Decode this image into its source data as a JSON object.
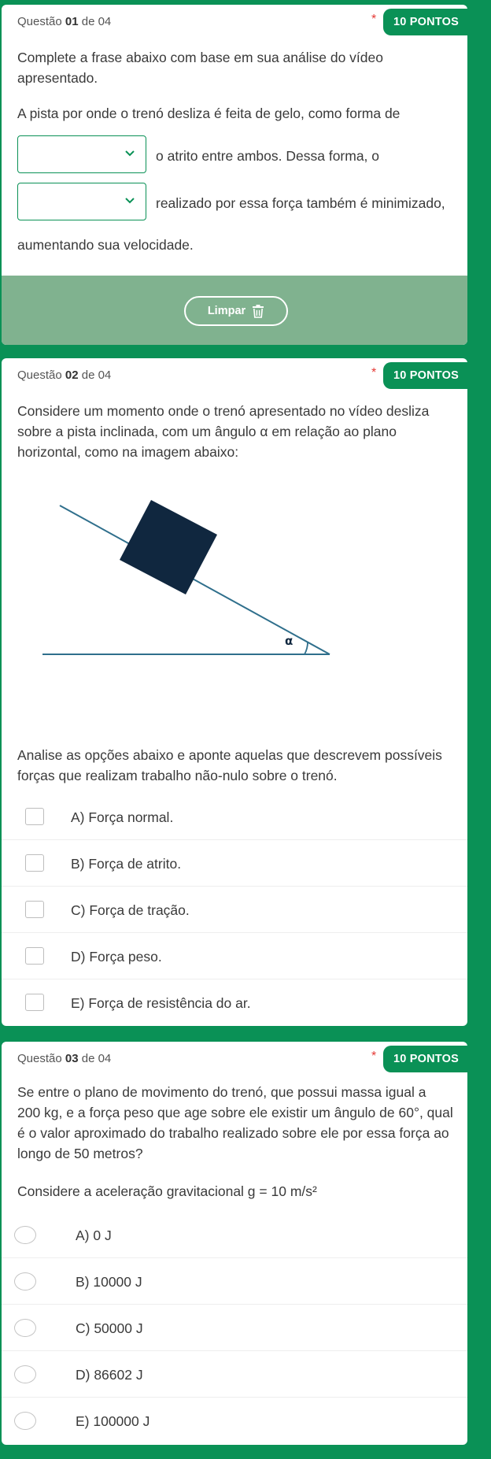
{
  "q1": {
    "label_prefix": "Questão ",
    "number": "01",
    "label_suffix": " de 04",
    "required_mark": "*",
    "points": "10 PONTOS",
    "prompt": "Complete a frase abaixo com base em sua análise do vídeo apresentado.",
    "sentence_start": "A pista por onde o trenó desliza é feita de gelo, como forma de",
    "after_select1": "o atrito entre ambos. Dessa forma, o",
    "after_select2": "realizado por essa força também é minimizado,",
    "sentence_end": "aumentando sua velocidade.",
    "select1_value": "",
    "select2_value": "",
    "clear_label": "Limpar"
  },
  "q2": {
    "label_prefix": "Questão ",
    "number": "02",
    "label_suffix": " de 04",
    "required_mark": "*",
    "points": "10 PONTOS",
    "prompt_line1": "Considere um momento onde o trenó apresentado no vídeo desliza",
    "prompt_line2": "sobre a pista inclinada, com um ângulo α em relação ao plano",
    "prompt_line3": "horizontal, como na imagem abaixo:",
    "figure_angle_label": "α",
    "instruction_line1": "Analise as opções abaixo e aponte aquelas que descrevem possíveis",
    "instruction_line2": "forças que realizam trabalho não-nulo sobre o trenó.",
    "options": [
      "A) Força normal.",
      "B) Força de atrito.",
      "C) Força de tração.",
      "D) Força peso.",
      "E) Força de resistência do ar."
    ]
  },
  "q3": {
    "label_prefix": "Questão ",
    "number": "03",
    "label_suffix": " de 04",
    "required_mark": "*",
    "points": "10 PONTOS",
    "prompt_line1": "Se entre o plano de movimento do trenó, que possui massa igual a",
    "prompt_line2": "200 kg, e a força peso que age sobre ele existir um ângulo de 60°, qual",
    "prompt_line3": "é o valor aproximado do trabalho realizado sobre ele por essa força ao",
    "prompt_line4": "longo de 50 metros?",
    "hint": "Considere a aceleração gravitacional g = 10 m/s²",
    "options": [
      "A) 0 J",
      "B) 10000 J",
      "C) 50000 J",
      "D) 86602 J",
      "E) 100000 J"
    ]
  },
  "colors": {
    "accent": "#0a9156",
    "clear_bar": "#80b28f",
    "required": "#e53935",
    "figure_dark": "#10273f",
    "figure_line": "#2f6f8c"
  }
}
